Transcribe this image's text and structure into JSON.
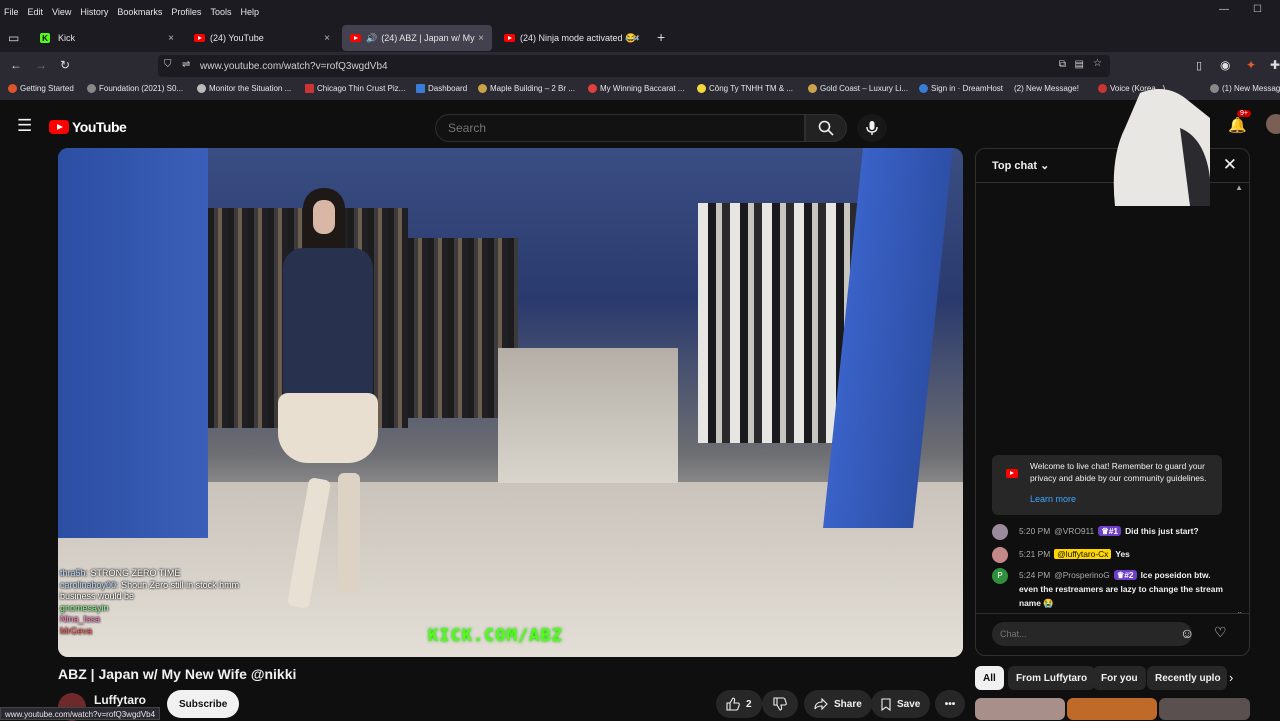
{
  "browser": {
    "menu": [
      "File",
      "Edit",
      "View",
      "History",
      "Bookmarks",
      "Profiles",
      "Tools",
      "Help"
    ],
    "tabs": [
      {
        "label": "Kick",
        "close": "×"
      },
      {
        "label": "(24) YouTube",
        "close": "×"
      },
      {
        "label": "(24) ABZ | Japan w/ My Ne",
        "close": "×"
      },
      {
        "label": "(24) Ninja mode activated 😂😂",
        "close": "×"
      }
    ],
    "url": "www.youtube.com/watch?v=rofQ3wgdVb4",
    "bookmarks": [
      "Getting Started",
      "Foundation (2021) S0...",
      "Monitor the Situation ...",
      "Chicago Thin Crust Piz...",
      "Dashboard",
      "Maple Building – 2 Br ...",
      "My Winning Baccarat ...",
      "Công Ty TNHH TM & ...",
      "Gold Coast – Luxury Li...",
      "Sign in · DreamHost",
      "(2) New Message!",
      "Voice (Korea...)",
      "(1) New Messag"
    ],
    "status_url": "www.youtube.com/watch?v=rofQ3wgdVb4"
  },
  "youtube": {
    "logo": "YouTube",
    "search_placeholder": "Search",
    "notif_count": "9+"
  },
  "video": {
    "title": "ABZ | Japan w/ My New Wife @nikki",
    "watermark": "KICK.COM/ABZ",
    "overlay_chat": [
      {
        "user": "thra5h:",
        "text": "STRONG ZERO TIME"
      },
      {
        "user": "carolinaboy00:",
        "text": "Shoun Zero still in stock hmm"
      },
      {
        "user": "",
        "text": "business would be"
      },
      {
        "user": "gnomesayin",
        "text": ""
      },
      {
        "user": "Nina_Issa",
        "text": ""
      },
      {
        "user": "MrGeva",
        "text": ""
      }
    ]
  },
  "channel": {
    "name": "Luffytaro",
    "subscribe": "Subscribe",
    "likes": "2",
    "share": "Share",
    "save": "Save"
  },
  "chat": {
    "header": "Top chat",
    "welcome": "Welcome to live chat! Remember to guard your privacy and abide by our community guidelines.",
    "learn_more": "Learn more",
    "messages": [
      {
        "time": "5:20 PM",
        "author": "@VRO911",
        "badge": "#1",
        "text": "Did this just start?"
      },
      {
        "time": "5:21 PM",
        "author": "@luffytaro-Cx",
        "text": "Yes"
      },
      {
        "time": "5:24 PM",
        "author": "@ProsperinoG",
        "badge": "#2",
        "text": "Ice poseidon btw. even the restreamers are lazy to change the stream name 😭"
      }
    ],
    "input_placeholder": "Chat..."
  },
  "chips": [
    "All",
    "From Luffytaro",
    "For you",
    "Recently uplo"
  ],
  "colors": {
    "yt_red": "#ff0000",
    "kick_green": "#53fc18",
    "link_blue": "#3ea6ff"
  }
}
